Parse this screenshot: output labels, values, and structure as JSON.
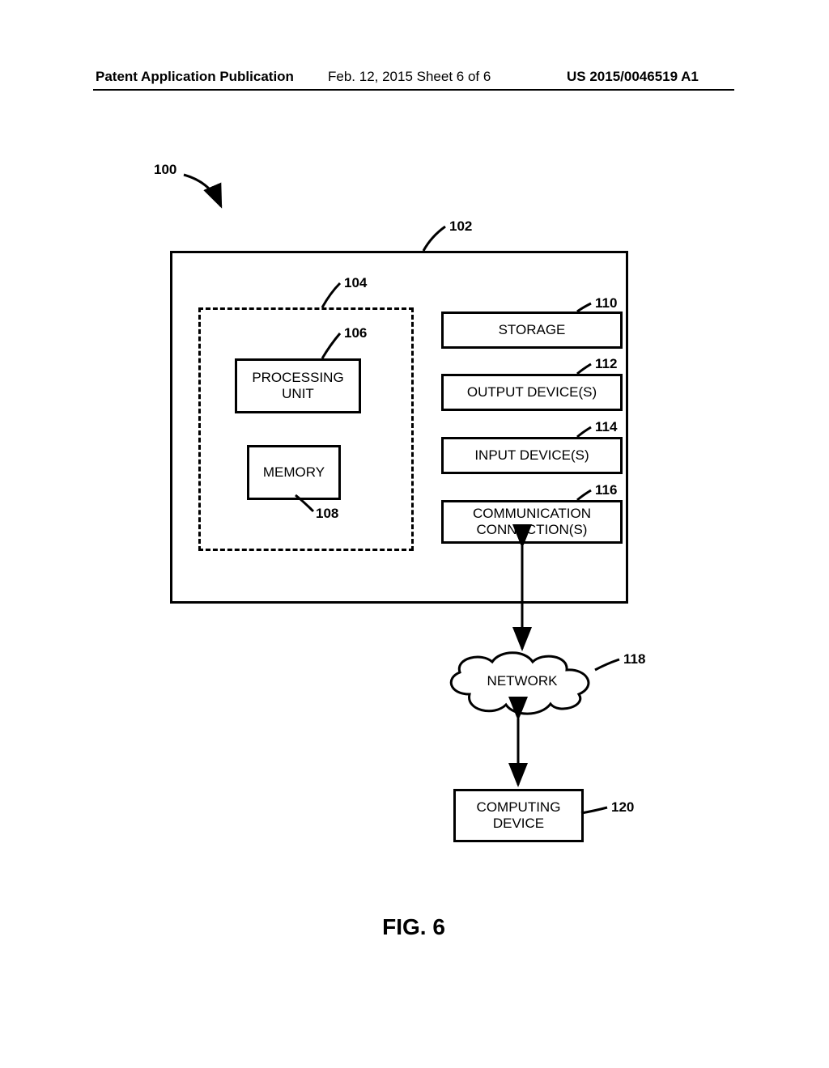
{
  "header": {
    "left": "Patent Application Publication",
    "mid": "Feb. 12, 2015  Sheet 6 of 6",
    "right": "US 2015/0046519 A1"
  },
  "refs": {
    "r100": "100",
    "r102": "102",
    "r104": "104",
    "r106": "106",
    "r108": "108",
    "r110": "110",
    "r112": "112",
    "r114": "114",
    "r116": "116",
    "r118": "118",
    "r120": "120"
  },
  "labels": {
    "processing_unit": "PROCESSING\nUNIT",
    "memory": "MEMORY",
    "storage": "STORAGE",
    "output": "OUTPUT DEVICE(S)",
    "input": "INPUT DEVICE(S)",
    "comm": "COMMUNICATION\nCONNECTION(S)",
    "network": "NETWORK",
    "computing_device": "COMPUTING\nDEVICE"
  },
  "figure": {
    "title": "FIG. 6"
  }
}
